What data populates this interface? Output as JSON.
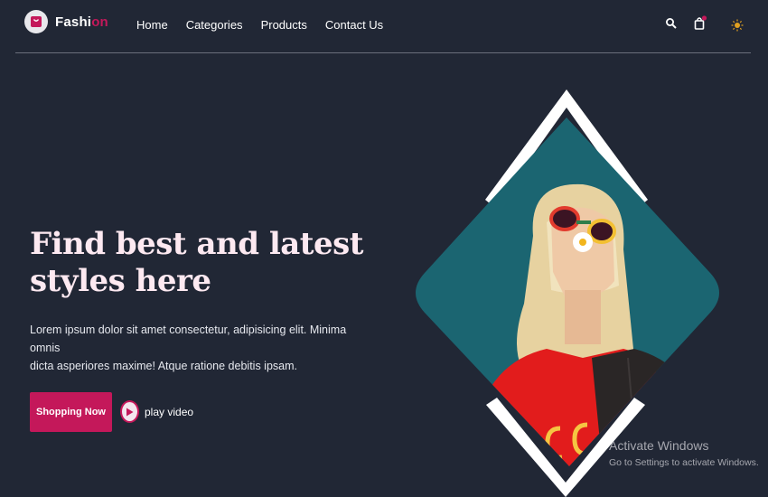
{
  "brand": {
    "name_main": "Fashi",
    "name_accent": "on"
  },
  "nav": {
    "items": [
      "Home",
      "Categories",
      "Products",
      "Contact Us"
    ]
  },
  "header_icons": [
    "search-icon",
    "shopping-bag-icon",
    "sun-icon"
  ],
  "hero": {
    "title_line1": "Find best and latest",
    "title_line2": "styles here",
    "description_line1": "Lorem ipsum dolor sit amet consectetur, adipisicing elit. Minima omnis",
    "description_line2": "dicta asperiores maxime! Atque ratione debitis ipsam.",
    "primary_cta": "Shopping Now",
    "secondary_cta": "play video"
  },
  "watermark": {
    "title": "Activate Windows",
    "subtitle": "Go to Settings to activate Windows."
  },
  "colors": {
    "background": "#212735",
    "accent": "#c4185a",
    "image_backdrop": "#1b6571",
    "frame": "#ffffff"
  }
}
